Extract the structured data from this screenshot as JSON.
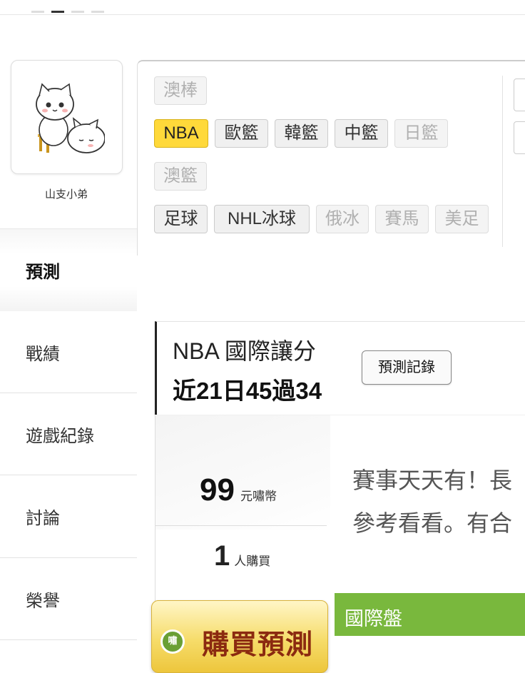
{
  "top": {
    "dots": [
      "inactive",
      "active",
      "inactive",
      "inactive"
    ]
  },
  "profile": {
    "username": "山支小弟",
    "avatar_icon": "cats-sticker-icon"
  },
  "sidebar": {
    "active": "預測",
    "items": [
      "戰績",
      "遊戲紀錄",
      "討論",
      "榮譽"
    ]
  },
  "categories": {
    "row1": [
      "澳棒"
    ],
    "row2": [
      "NBA",
      "歐籃",
      "韓籃",
      "中籃",
      "日籃"
    ],
    "row3": [
      "澳籃"
    ],
    "row4": [
      "足球",
      "NHL冰球",
      "俄冰",
      "賽馬",
      "美足"
    ],
    "selected": "NBA",
    "dimmed": [
      "澳棒",
      "日籃",
      "澳籃",
      "俄冰",
      "賽馬",
      "美足"
    ]
  },
  "record": {
    "title": "NBA 國際讓分",
    "summary": "近21日45過34",
    "history_button": "預測記錄"
  },
  "product": {
    "price": "99",
    "price_unit": "元嘯幣",
    "buyers": "1",
    "buyers_unit": "人購買",
    "desc_line1": "賽事天天有！長",
    "desc_line2": "參考看看。有合",
    "buy_button": "購買預測",
    "buy_icon_text": "嘯",
    "market_label": "國際盤"
  },
  "colors": {
    "selected_pill": "#ffd93a",
    "market_bar": "#79b83d",
    "buy_button_text": "#8b2a10"
  }
}
